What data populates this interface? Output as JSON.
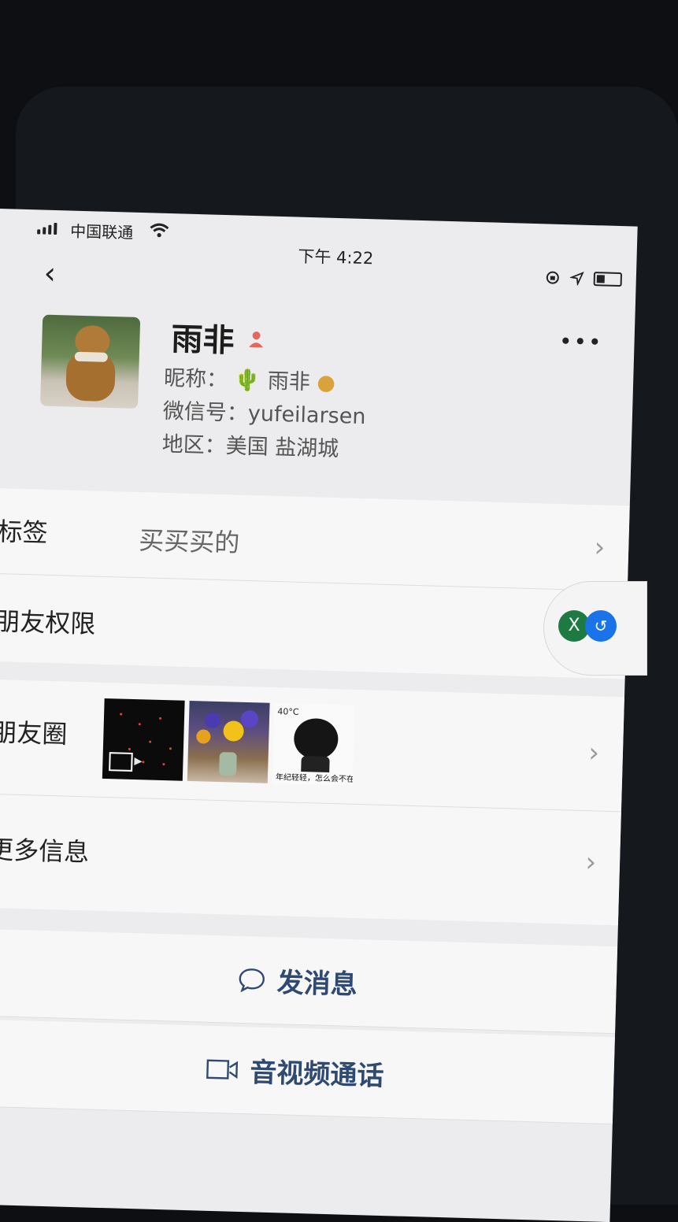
{
  "status_bar": {
    "carrier": "中国联通",
    "time": "下午 4:22"
  },
  "profile": {
    "name": "雨非",
    "nickname_label": "昵称：",
    "nickname_value": "雨非",
    "wechat_id_label": "微信号：",
    "wechat_id_value": "yufeilarsen",
    "region_label": "地区：",
    "region_value": "美国 盐湖城"
  },
  "rows": {
    "tags_label": "标签",
    "tags_value": "买买买的",
    "friend_permissions_label": "朋友权限",
    "moments_label": "朋友圈",
    "more_info_label": "更多信息"
  },
  "moments": {
    "sticker_top_text": "40°C",
    "sticker_caption": "年纪轻轻，怎么会不在"
  },
  "actions": {
    "send_message": "发消息",
    "voice_video_call": "音视频通话"
  },
  "colors": {
    "accent": "#2f4a72",
    "background": "#ececee"
  }
}
